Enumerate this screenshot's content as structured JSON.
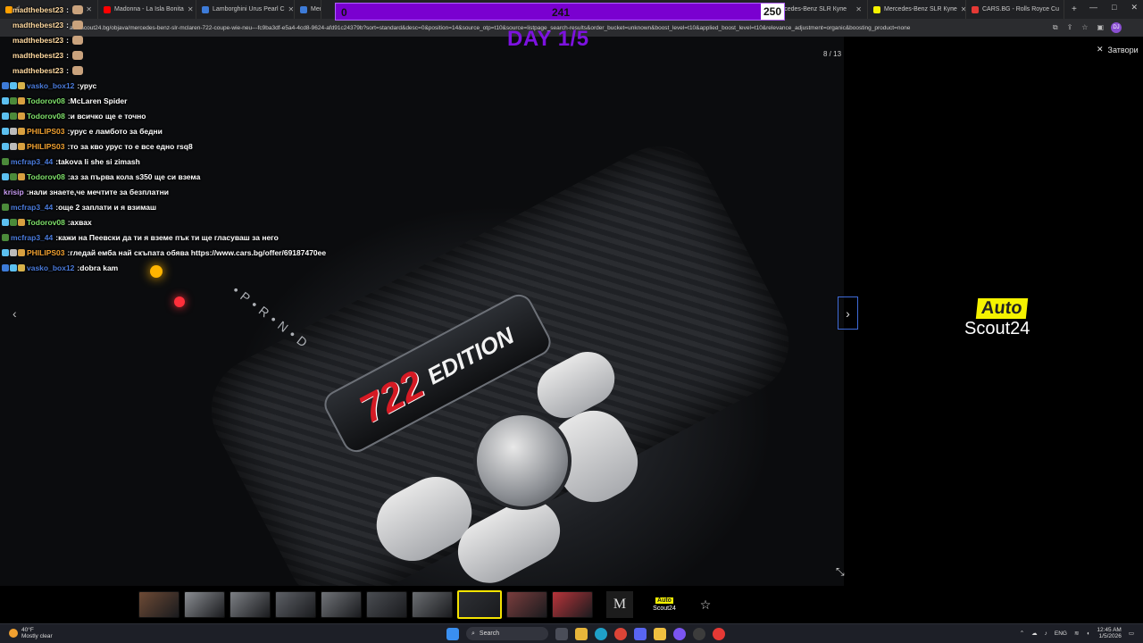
{
  "browser": {
    "tabs": [
      {
        "label": "d",
        "fav": "#ffa000"
      },
      {
        "label": "Madonna - La Isla Bonita",
        "fav": "#ff0000"
      },
      {
        "label": "Lamborghini Urus Pearl C",
        "fav": "#3d7bd8"
      },
      {
        "label": "Mercede",
        "fav": "#3d7bd8"
      },
      {
        "label": "ercedes-Benz SLR Купе",
        "fav": "#f5f200"
      },
      {
        "label": "Mercedes-Benz SLR Купе",
        "fav": "#f5f200"
      },
      {
        "label": "CARS.BG - Rolls Royce Cu",
        "fav": "#e53935"
      }
    ],
    "url": "autoscout24.bg/objava/mercedes-benz-slr-mclaren-722-coupe-wie-neu---fc9ba3df-e5a4-4cd8-9624-afd91c24379b?sort=standard&desc=0&position=14&source_otp=t10&source=listpage_search-results&order_bucket=unknown&boost_level=t10&applied_boost_level=t10&relevance_adjustment=organic&boosting_product=none",
    "profile": "DJ"
  },
  "subathon": {
    "start": "0",
    "current": "241",
    "goal": "250",
    "progress_fraction": 0.964,
    "day_label": "DAY 1/5"
  },
  "gallery": {
    "counter": "8 / 13",
    "close_label": "Затвори",
    "photo_text_number": "722",
    "photo_text_edition": "EDITION",
    "thumb_m": "M",
    "thumb_as_auto": "Auto",
    "thumb_as_scout": "Scout24",
    "logo_auto": "Auto",
    "logo_scout": "Scout24",
    "thumbnail_colors": [
      "#6d4a35",
      "#8a8d92",
      "#7c7f84",
      "#5d6066",
      "#707378",
      "#4a4d52",
      "#6b6e72",
      "#2e3035",
      "#7a3d3d",
      "#b8343a"
    ]
  },
  "chat": [
    {
      "user": "madthebest23",
      "color": "#ffd9a0",
      "text": "",
      "emote": true,
      "badges": []
    },
    {
      "user": "madthebest23",
      "color": "#ffd9a0",
      "text": "",
      "emote": true,
      "badges": []
    },
    {
      "user": "madthebest23",
      "color": "#ffd9a0",
      "text": "",
      "emote": true,
      "badges": []
    },
    {
      "user": "madthebest23",
      "color": "#ffd9a0",
      "text": "",
      "emote": true,
      "badges": []
    },
    {
      "user": "madthebest23",
      "color": "#ffd9a0",
      "text": "",
      "emote": true,
      "badges": []
    },
    {
      "user": "vasko_box12",
      "color": "#4a7bdc",
      "text": "урус",
      "emote": false,
      "badges": [
        "#3d7bd8",
        "#5cc0f0",
        "#d8b24a"
      ]
    },
    {
      "user": "Todorov08",
      "color": "#7ee06a",
      "text": "McLaren Spider",
      "emote": false,
      "badges": [
        "#5cc0f0",
        "#4b8a3a",
        "#d8a040"
      ]
    },
    {
      "user": "Todorov08",
      "color": "#7ee06a",
      "text": "и всичко ще е точно",
      "emote": false,
      "badges": [
        "#5cc0f0",
        "#4b8a3a",
        "#d8a040"
      ]
    },
    {
      "user": "PHILIPS03",
      "color": "#f0a030",
      "text": "урус е ламбото за бедни",
      "emote": false,
      "badges": [
        "#5cc0f0",
        "#bbbbbb",
        "#d8a040"
      ]
    },
    {
      "user": "PHILIPS03",
      "color": "#f0a030",
      "text": "то за кво урус то е все едно rsq8",
      "emote": false,
      "badges": [
        "#5cc0f0",
        "#bbbbbb",
        "#d8a040"
      ]
    },
    {
      "user": "mcfrap3_44",
      "color": "#4a7bdc",
      "text": "takova li she si zimash",
      "emote": false,
      "badges": [
        "#4b8a3a"
      ]
    },
    {
      "user": "Todorov08",
      "color": "#7ee06a",
      "text": "аз за първа кола s350 ще си взема",
      "emote": false,
      "badges": [
        "#5cc0f0",
        "#4b8a3a",
        "#d8a040"
      ]
    },
    {
      "user": "krisip",
      "color": "#c79bf2",
      "text": "нали знаете,че мечтите за безплатни",
      "emote": false,
      "badges": []
    },
    {
      "user": "mcfrap3_44",
      "color": "#4a7bdc",
      "text": "още 2 заплати и я взимаш",
      "emote": false,
      "badges": [
        "#4b8a3a"
      ]
    },
    {
      "user": "Todorov08",
      "color": "#7ee06a",
      "text": "ахвах",
      "emote": false,
      "badges": [
        "#5cc0f0",
        "#4b8a3a",
        "#d8a040"
      ]
    },
    {
      "user": "mcfrap3_44",
      "color": "#4a7bdc",
      "text": "кажи на Пеевски да ти я вземе пък ти ще гласуваш за него",
      "emote": false,
      "badges": [
        "#4b8a3a"
      ]
    },
    {
      "user": "PHILIPS03",
      "color": "#f0a030",
      "text": "гледай ембa най скъпата обява https://www.cars.bg/offer/69187470ee",
      "emote": false,
      "badges": [
        "#5cc0f0",
        "#bbbbbb",
        "#d8a040"
      ]
    },
    {
      "user": "vasko_box12",
      "color": "#4a7bdc",
      "text": "dobra kam",
      "emote": false,
      "badges": [
        "#3d7bd8",
        "#5cc0f0",
        "#d8b24a"
      ]
    }
  ],
  "taskbar": {
    "temp": "40°F",
    "weather": "Mostly clear",
    "search": "Search",
    "lang": "ENG",
    "time": "12:45 AM",
    "date": "1/5/2026"
  }
}
